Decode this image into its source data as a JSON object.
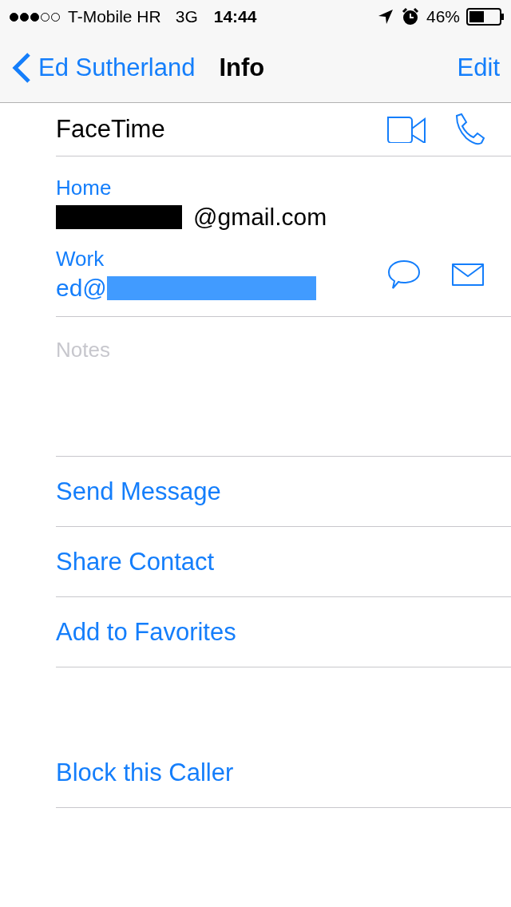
{
  "status_bar": {
    "signal_dots": [
      {
        "filled": true
      },
      {
        "filled": true
      },
      {
        "filled": true
      },
      {
        "filled": false
      },
      {
        "filled": false
      }
    ],
    "carrier": "T-Mobile HR",
    "network": "3G",
    "time": "14:44",
    "battery": "46%"
  },
  "nav": {
    "back": "Ed Sutherland",
    "title": "Info",
    "action": "Edit"
  },
  "facetime": {
    "label": "FaceTime"
  },
  "emails": [
    {
      "label": "Home",
      "parts": [
        {
          "kind": "redacted"
        },
        {
          "kind": "text",
          "text": "@gmail.com"
        }
      ],
      "actions": false
    },
    {
      "label": "Work",
      "parts": [
        {
          "kind": "text",
          "text": "ed@"
        },
        {
          "kind": "redacted"
        }
      ],
      "actions": true
    }
  ],
  "notes": {
    "placeholder": "Notes"
  },
  "actions": [
    {
      "label": "Send Message"
    },
    {
      "label": "Share Contact"
    },
    {
      "label": "Add to Favorites"
    }
  ],
  "block": {
    "label": "Block this Caller"
  }
}
